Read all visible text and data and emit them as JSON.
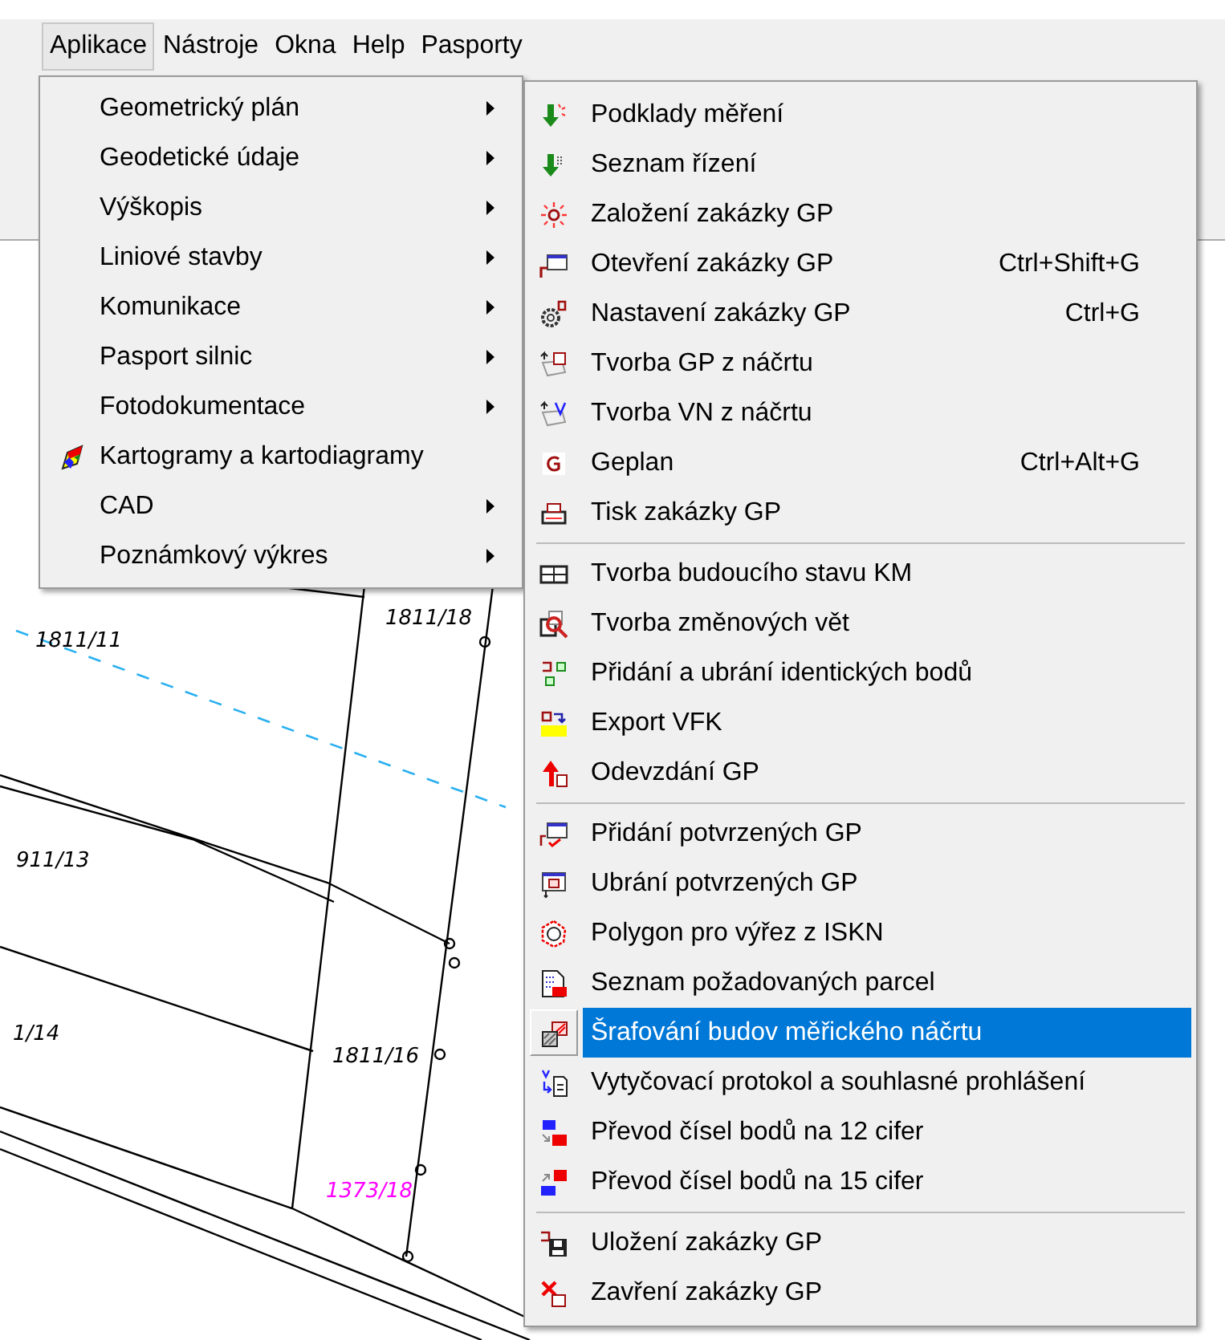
{
  "menu_bar": [
    {
      "label": "Aplikace",
      "selected": true
    },
    {
      "label": "Nástroje",
      "selected": false
    },
    {
      "label": "Okna",
      "selected": false
    },
    {
      "label": "Help",
      "selected": false
    },
    {
      "label": "Pasporty",
      "selected": false
    }
  ],
  "app_menu": {
    "items": [
      {
        "label": "Geometrický plán",
        "kind": "submenu",
        "selected": false
      },
      {
        "label": "Geodetické údaje",
        "kind": "submenu",
        "selected": false
      },
      {
        "label": "Výškopis",
        "kind": "submenu",
        "selected": false
      },
      {
        "label": "Liniové stavby",
        "kind": "submenu",
        "selected": false
      },
      {
        "label": "Komunikace",
        "kind": "submenu",
        "selected": false
      },
      {
        "label": "Pasport silnic",
        "kind": "submenu",
        "selected": false
      },
      {
        "label": "Fotodokumentace",
        "kind": "submenu",
        "selected": false
      },
      {
        "label": "Kartogramy a kartodiagramy",
        "kind": "command",
        "selected": false
      },
      {
        "label": "CAD",
        "kind": "submenu",
        "selected": false
      },
      {
        "label": "Poznámkový výkres",
        "kind": "submenu",
        "selected": false
      }
    ]
  },
  "gp_submenu": {
    "sections": [
      {
        "items": [
          {
            "label": "Podklady měření",
            "selected": false
          },
          {
            "label": "Seznam řízení",
            "selected": false
          },
          {
            "label": "Založení zakázky GP",
            "selected": false
          },
          {
            "label": "Otevření zakázky GP",
            "shortcut": "Ctrl+Shift+G",
            "selected": false
          },
          {
            "label": "Nastavení zakázky GP",
            "shortcut": "Ctrl+G",
            "selected": false
          },
          {
            "label": "Tvorba GP z náčrtu",
            "selected": false
          },
          {
            "label": "Tvorba VN z náčrtu",
            "selected": false
          },
          {
            "label": "Geplan",
            "shortcut": "Ctrl+Alt+G",
            "selected": false
          },
          {
            "label": "Tisk zakázky GP",
            "selected": false
          }
        ]
      },
      {
        "items": [
          {
            "label": "Tvorba budoucího stavu KM",
            "selected": false
          },
          {
            "label": "Tvorba změnových vět",
            "selected": false
          },
          {
            "label": "Přidání a ubrání identických bodů",
            "selected": false
          },
          {
            "label": "Export VFK",
            "selected": false
          },
          {
            "label": "Odevzdání GP",
            "selected": false
          }
        ]
      },
      {
        "items": [
          {
            "label": "Přidání potvrzených GP",
            "selected": false
          },
          {
            "label": "Ubrání potvrzených GP",
            "selected": false
          },
          {
            "label": "Polygon pro výřez z ISKN",
            "selected": false
          },
          {
            "label": "Seznam požadovaných parcel",
            "selected": false
          },
          {
            "label": "Šrafování budov měřického náčrtu",
            "selected": true
          },
          {
            "label": "Vytyčovací protokol a souhlasné prohlášení",
            "selected": false
          },
          {
            "label": "Převod čísel bodů na 12 cifer",
            "selected": false
          },
          {
            "label": "Převod čísel bodů na 15 cifer",
            "selected": false
          }
        ]
      },
      {
        "items": [
          {
            "label": "Uložení zakázky GP",
            "selected": false
          },
          {
            "label": "Zavření zakázky GP",
            "selected": false
          }
        ]
      }
    ]
  },
  "map": {
    "labels": [
      {
        "text": "1811/18",
        "color": "#000000"
      },
      {
        "text": "1811/11",
        "color": "#000000"
      },
      {
        "text": "911/13",
        "color": "#000000"
      },
      {
        "text": "1/14",
        "color": "#000000"
      },
      {
        "text": "1811/16",
        "color": "#000000"
      },
      {
        "text": "1373/18",
        "color": "#ff00ff"
      }
    ]
  }
}
